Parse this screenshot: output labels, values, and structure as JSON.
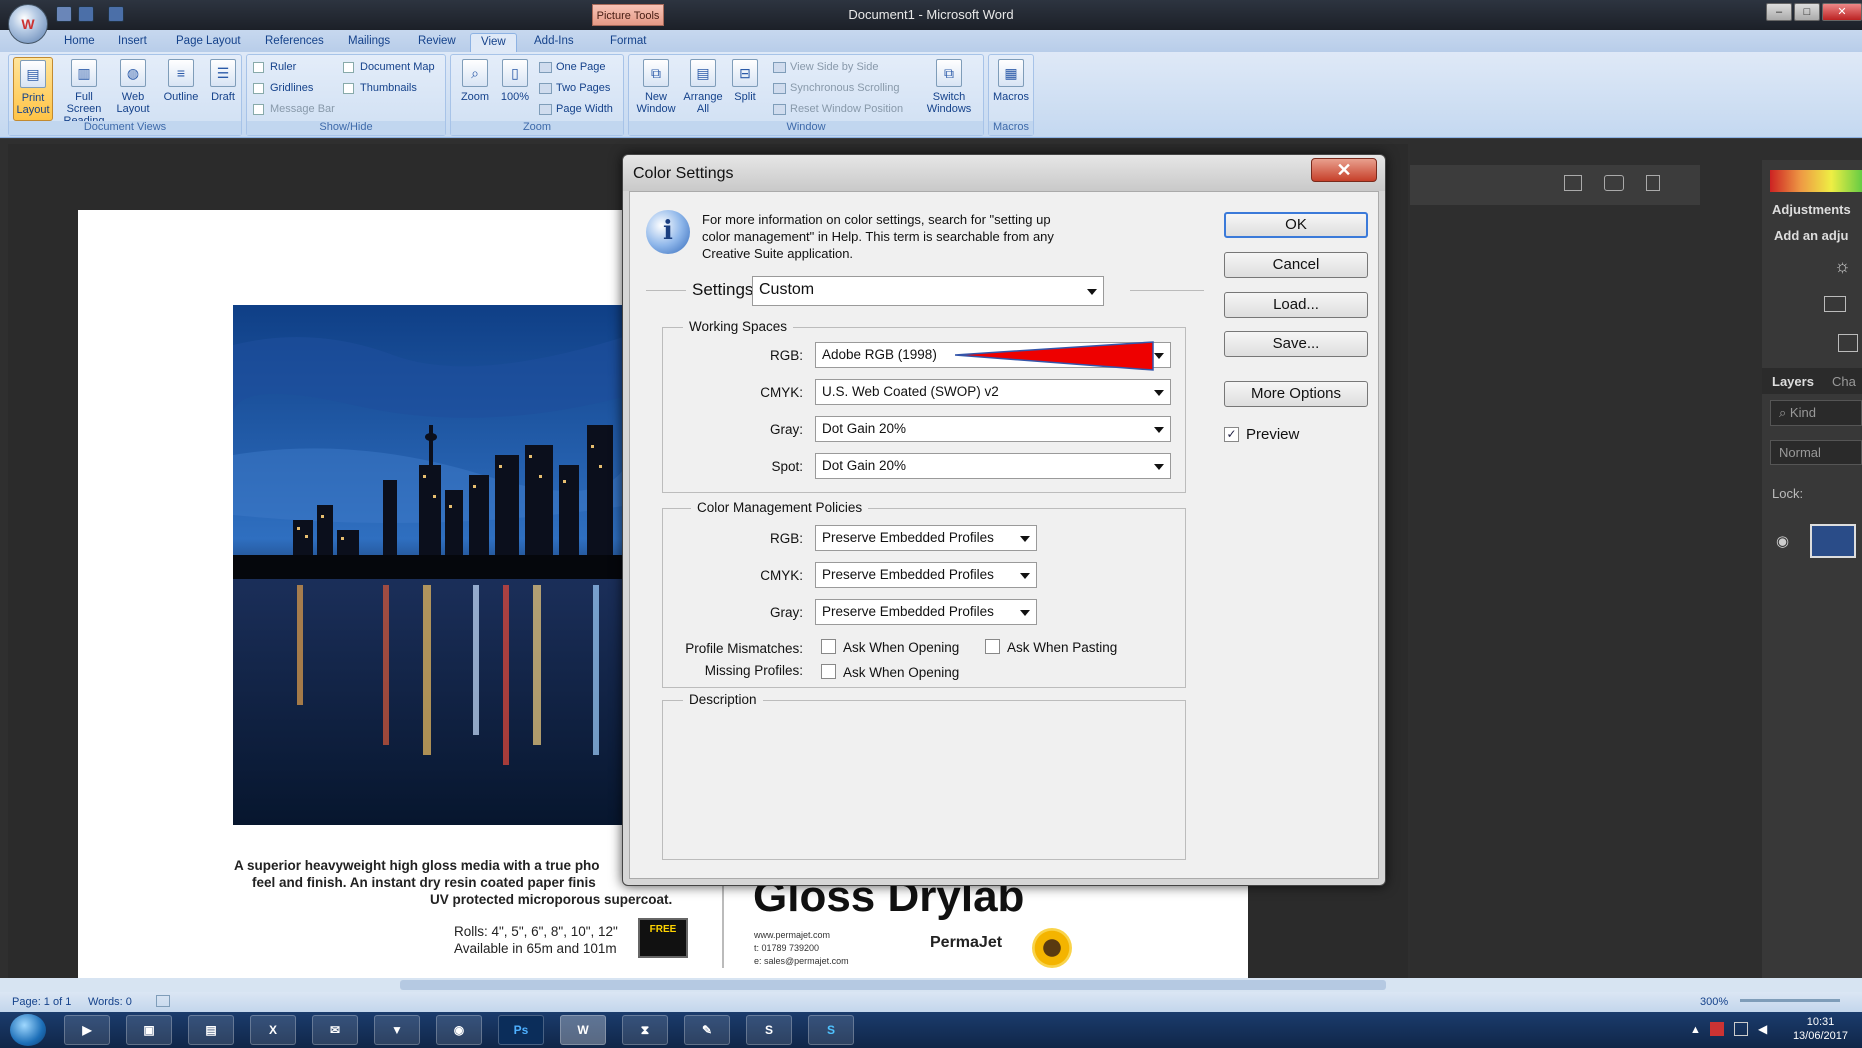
{
  "window": {
    "title": "Document1 - Microsoft Word",
    "context_tab": "Picture Tools",
    "office_button": "W"
  },
  "tabs": [
    "Home",
    "Insert",
    "Page Layout",
    "References",
    "Mailings",
    "Review",
    "View",
    "Add-Ins",
    "Format"
  ],
  "ribbon": {
    "document_views": {
      "label": "Document Views",
      "buttons": [
        "Print Layout",
        "Full Screen Reading",
        "Web Layout",
        "Outline",
        "Draft"
      ]
    },
    "show_hide": {
      "label": "Show/Hide",
      "items": [
        "Ruler",
        "Gridlines",
        "Message Bar",
        "Document Map",
        "Thumbnails"
      ]
    },
    "zoom": {
      "label": "Zoom",
      "buttons": [
        "Zoom",
        "100%"
      ],
      "items": [
        "One Page",
        "Two Pages",
        "Page Width"
      ]
    },
    "window_group": {
      "label": "Window",
      "buttons": [
        "New Window",
        "Arrange All",
        "Split"
      ],
      "items": [
        "View Side by Side",
        "Synchronous Scrolling",
        "Reset Window Position"
      ],
      "switch": "Switch Windows"
    },
    "macros": {
      "label": "Macros",
      "button": "Macros"
    }
  },
  "document": {
    "caption_line1": "A superior heavyweight high gloss media with a true pho",
    "caption_line2": "feel and finish. An instant dry resin coated paper finis",
    "caption_line3": "UV protected microporous supercoat.",
    "rolls_line1": "Rolls: 4\", 5\", 6\", 8\", 10\", 12\"",
    "rolls_line2": "Available in 65m and 101m",
    "free_badge": "FREE",
    "headline": "Gloss Drylab",
    "contact_web": "www.permajet.com",
    "contact_phone": "t: 01789 739200",
    "contact_email": "e: sales@permajet.com",
    "brand": "PermaJet"
  },
  "dialog": {
    "title": "Color Settings",
    "info_line1": "For more information on color settings, search for \"setting up",
    "info_line2": "color management\" in Help. This term is searchable from any",
    "info_line3": "Creative Suite application.",
    "settings_label": "Settings:",
    "settings_value": "Custom",
    "working_spaces": {
      "legend": "Working Spaces",
      "rgb_label": "RGB:",
      "rgb_value": "Adobe RGB (1998)",
      "cmyk_label": "CMYK:",
      "cmyk_value": "U.S. Web Coated (SWOP) v2",
      "gray_label": "Gray:",
      "gray_value": "Dot Gain 20%",
      "spot_label": "Spot:",
      "spot_value": "Dot Gain 20%"
    },
    "policies": {
      "legend": "Color Management Policies",
      "rgb_label": "RGB:",
      "rgb_value": "Preserve Embedded Profiles",
      "cmyk_label": "CMYK:",
      "cmyk_value": "Preserve Embedded Profiles",
      "gray_label": "Gray:",
      "gray_value": "Preserve Embedded Profiles",
      "mismatch_label": "Profile Mismatches:",
      "ask_opening": "Ask When Opening",
      "ask_pasting": "Ask When Pasting",
      "missing_label": "Missing Profiles:",
      "missing_ask": "Ask When Opening"
    },
    "description_legend": "Description",
    "buttons": {
      "ok": "OK",
      "cancel": "Cancel",
      "load": "Load...",
      "save": "Save...",
      "more": "More Options"
    },
    "preview_label": "Preview",
    "close_glyph": "✕"
  },
  "photoshop": {
    "adjustments": "Adjustments",
    "add_adj": "Add an adju",
    "layers_tab": "Layers",
    "channels_tab": "Cha",
    "kind": "Kind",
    "blend": "Normal",
    "lock": "Lock:"
  },
  "statusbar": {
    "page": "Page: 1 of 1",
    "words": "Words: 0",
    "zoom": "300%"
  },
  "taskbar": {
    "ps": "Ps",
    "time": "10:31",
    "date": "13/06/2017"
  }
}
